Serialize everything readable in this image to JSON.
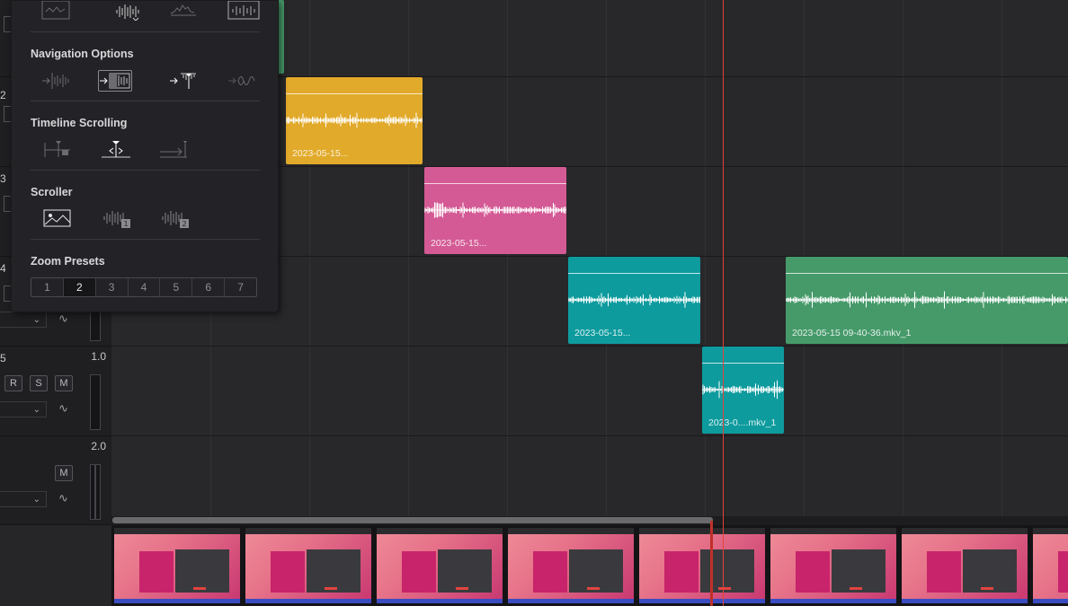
{
  "tracks": [
    {
      "num": "2"
    },
    {
      "num": "3"
    },
    {
      "num": "4"
    },
    {
      "num": "5",
      "volume": "1.0",
      "buttons": [
        "R",
        "S",
        "M"
      ]
    },
    {
      "volume": "2.0",
      "buttons": [
        "M"
      ]
    }
  ],
  "clips": [
    {
      "name": "2023-05-15...",
      "color": "#e2aa2a"
    },
    {
      "name": "2023-05-15...",
      "color": "#d45a95"
    },
    {
      "name": "2023-05-15...",
      "color": "#0e9b9e"
    },
    {
      "name": "2023-05-15 09-40-36.mkv_1",
      "color": "#469a6a"
    },
    {
      "name": "2023-0....mkv_1",
      "color": "#0e9b9e"
    }
  ],
  "options_panel": {
    "navigation_title": "Navigation Options",
    "scrolling_title": "Timeline Scrolling",
    "scroller_title": "Scroller",
    "zoom_title": "Zoom Presets",
    "zoom_presets": [
      "1",
      "2",
      "3",
      "4",
      "5",
      "6",
      "7"
    ],
    "zoom_selected": "2",
    "scroller_badges": [
      "1",
      "2"
    ]
  },
  "colors": {
    "playhead": "#e2423b",
    "accent": "#e2aa2a"
  }
}
